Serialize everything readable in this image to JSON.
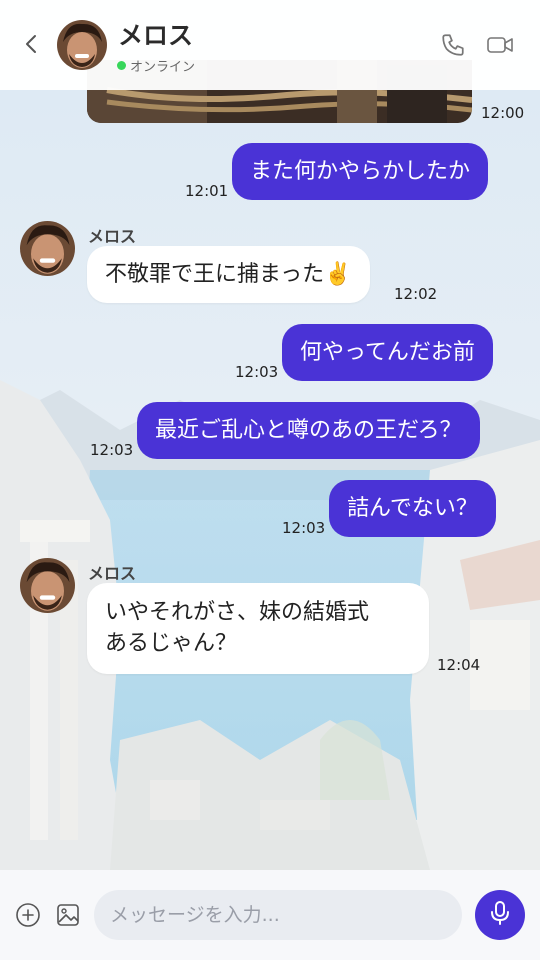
{
  "header": {
    "contact_name": "メロス",
    "status": "オンライン"
  },
  "messages": [
    {
      "id": "m0",
      "side": "out",
      "type": "image",
      "time": "12:00"
    },
    {
      "id": "m1",
      "side": "out",
      "text": "また何かやらかしたか",
      "time": "12:01"
    },
    {
      "id": "m2",
      "side": "in",
      "sender": "メロス",
      "text": "不敬罪で王に捕まった✌️",
      "time": "12:02"
    },
    {
      "id": "m3",
      "side": "out",
      "text": "何やってんだお前",
      "time": "12:03"
    },
    {
      "id": "m4",
      "side": "out",
      "text": "最近ご乱心と噂のあの王だろ？",
      "time": "12:03"
    },
    {
      "id": "m5",
      "side": "out",
      "text": "詰んでない？",
      "time": "12:03"
    },
    {
      "id": "m6",
      "side": "in",
      "sender": "メロス",
      "text_line1": "いやそれがさ、妹の結婚式",
      "text_line2": "あるじゃん？",
      "time": "12:04"
    }
  ],
  "input": {
    "placeholder": "メッセージを入力..."
  },
  "colors": {
    "accent": "#4a33d6",
    "online": "#37d65a"
  },
  "icons": [
    "back-icon",
    "phone-icon",
    "video-icon",
    "plus-icon",
    "image-icon",
    "mic-icon"
  ]
}
